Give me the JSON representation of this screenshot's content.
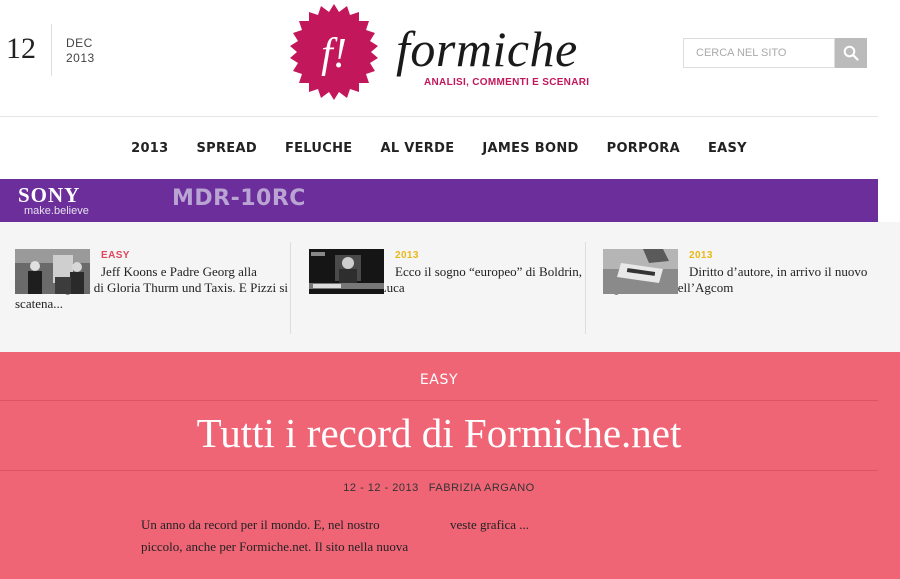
{
  "date": {
    "day": "12",
    "month": "DEC",
    "year": "2013"
  },
  "logo": {
    "badge": "f!",
    "wordmark": "formiche",
    "tagline": "ANALISI, COMMENTI E SCENARI"
  },
  "search": {
    "placeholder": "CERCA NEL SITO",
    "icon": "search-icon"
  },
  "nav": [
    "2013",
    "SPREAD",
    "FELUCHE",
    "AL VERDE",
    "JAMES BOND",
    "PORPORA",
    "EASY"
  ],
  "ad": {
    "brand": "SONY",
    "tagline": "make.believe",
    "model": "MDR-10RC",
    "color": "#6b2e9a"
  },
  "featured": [
    {
      "category": "EASY",
      "category_color": "#e0455e",
      "title": "Jeff Koons e Padre Georg alla mostra segreta di Gloria Thurm und Taxis. E Pizzi si scatena..."
    },
    {
      "category": "2013",
      "category_color": "#e8b817",
      "title": "Ecco il sogno “europeo” di Boldrin, Passera e De Luca"
    },
    {
      "category": "2013",
      "category_color": "#e8b817",
      "title": "Diritto d’autore, in arrivo il nuovo regolamento dell’Agcom"
    }
  ],
  "article": {
    "category": "EASY",
    "title": "Tutti i record di Formiche.net",
    "date": "12 - 12 - 2013",
    "author": "FABRIZIA ARGANO",
    "excerpt_left": "Un anno da record per il mondo. E, nel nostro piccolo, anche per Formiche.net. Il sito nella nuova",
    "excerpt_right": "veste grafica ...",
    "background": "#ef6576"
  }
}
